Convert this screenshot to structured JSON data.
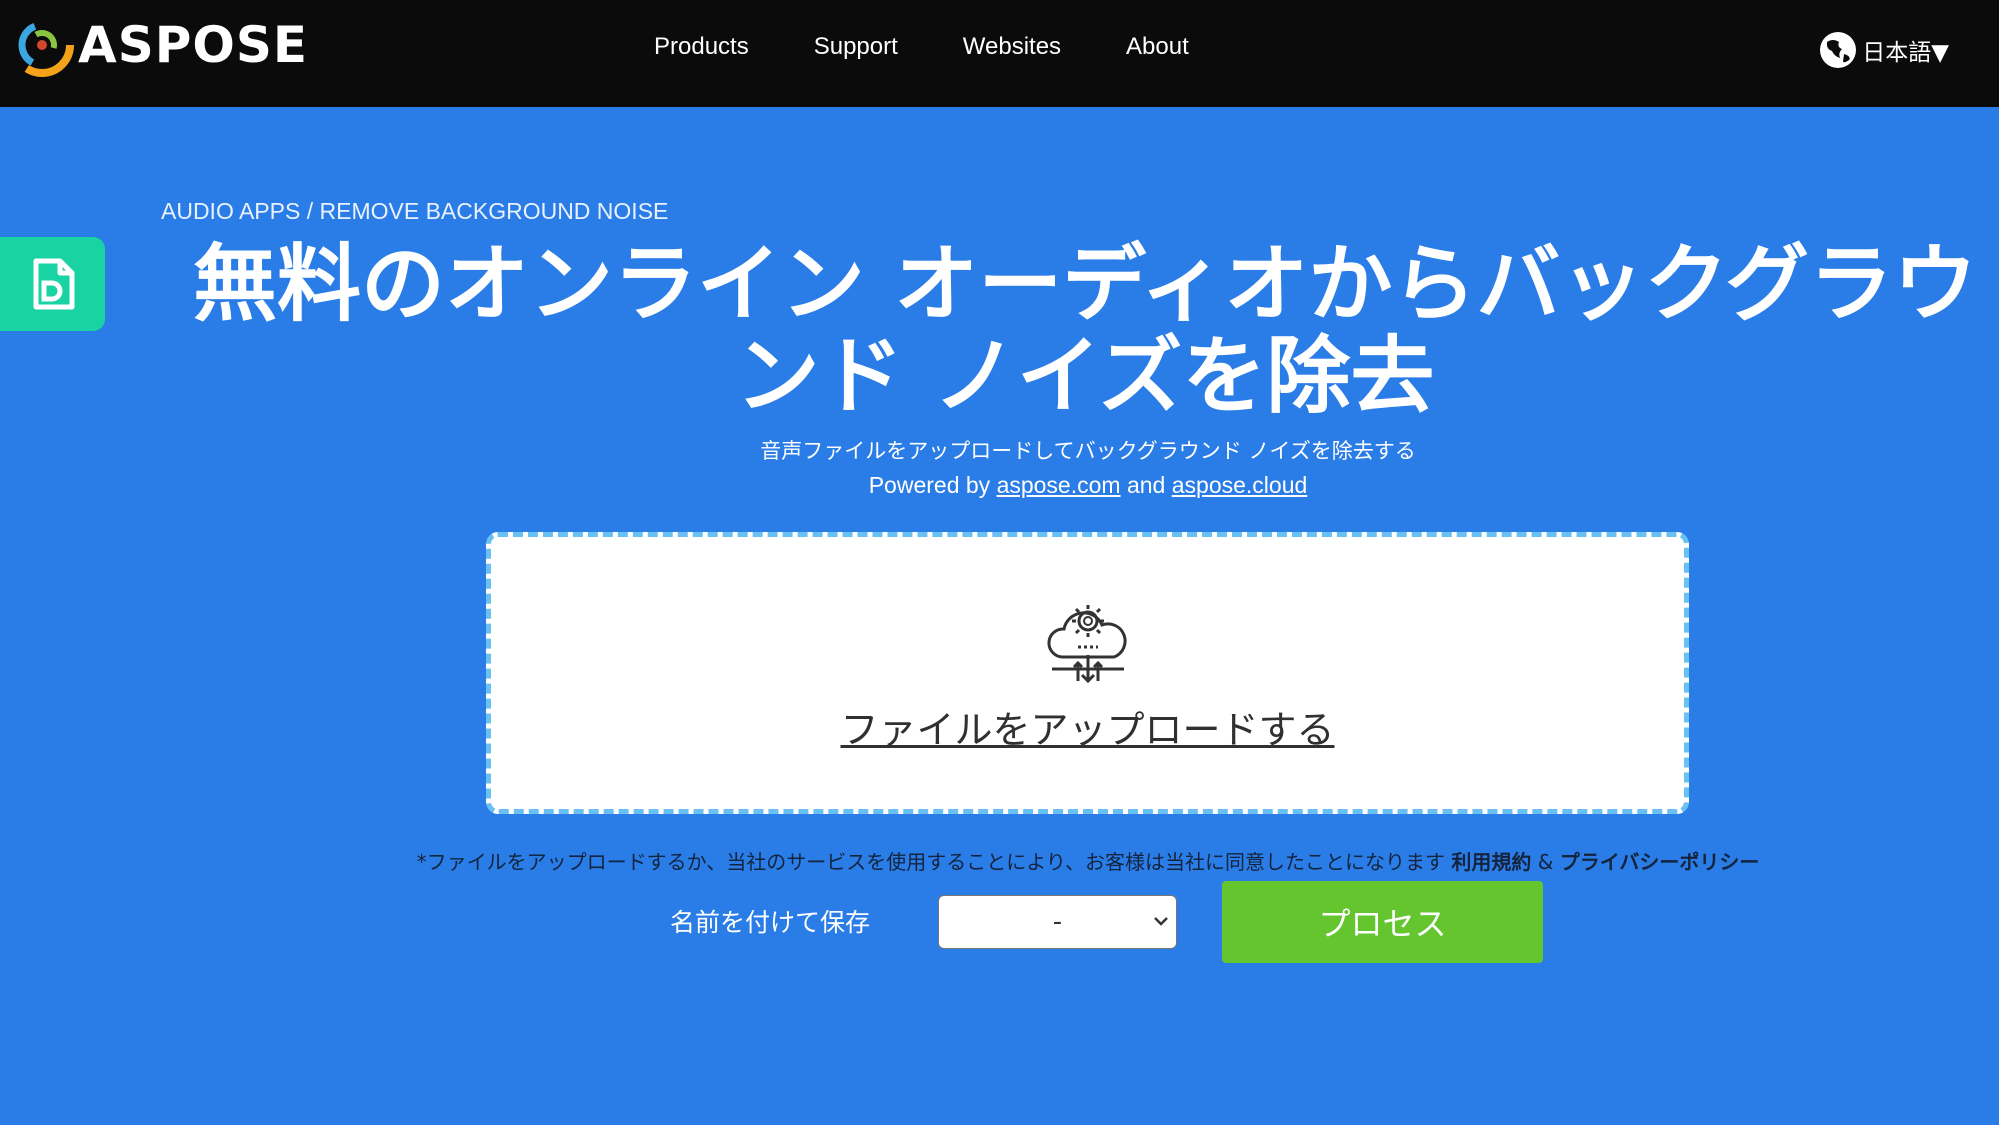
{
  "header": {
    "logo_text": "ASPOSE",
    "nav": [
      "Products",
      "Support",
      "Websites",
      "About"
    ],
    "language": "日本語▼"
  },
  "hero": {
    "breadcrumb": "AUDIO APPS / REMOVE BACKGROUND NOISE",
    "title_line1": "無料のオンライン オーディオからバックグラウ",
    "title_line2": "ンド ノイズを除去",
    "subtitle": "音声ファイルをアップロードしてバックグラウンド ノイズを除去する",
    "powered_prefix": "Powered by",
    "powered_link1": "aspose.com",
    "powered_and": "and",
    "powered_link2": "aspose.cloud"
  },
  "upload": {
    "link_text": "ファイルをアップロードする"
  },
  "terms": {
    "text": "*ファイルをアップロードするか、当社のサービスを使用することにより、お客様は当社に同意したことになります",
    "terms_link": "利用規約",
    "amp": "&",
    "privacy_link": "プライバシーポリシー"
  },
  "controls": {
    "save_as_label": "名前を付けて保存",
    "format_selected": "-",
    "process_label": "プロセス"
  },
  "colors": {
    "header_bg": "#0b0b0b",
    "hero_bg": "#2a7de7",
    "side_tab": "#1ad3a3",
    "process_button": "#64c52f",
    "upload_border": "#69c1f3"
  },
  "icons": [
    "aspose-logo-icon",
    "globe-icon",
    "document-icon",
    "cloud-upload-gear-icon",
    "chevron-down-icon"
  ]
}
